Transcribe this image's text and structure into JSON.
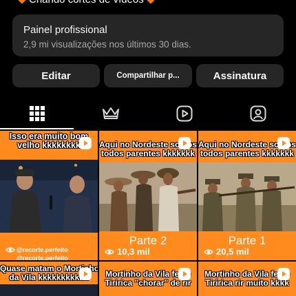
{
  "topline": {
    "text": "Criando cortes de vídeos"
  },
  "panel": {
    "title": "Painel profissional",
    "subtitle": "2,9 mi visualizações nos últimos 30 dias."
  },
  "buttons": {
    "edit": "Editar",
    "share": "Compartilhar p...",
    "subscription": "Assinatura"
  },
  "tabs": [
    {
      "icon": "grid-icon"
    },
    {
      "icon": "crown-icon"
    },
    {
      "icon": "reels-icon"
    },
    {
      "icon": "tagged-icon"
    }
  ],
  "posts": [
    {
      "caption_line1": "Isso era muito bom",
      "caption_line2": "velho kkkkkkkk",
      "handle1": "@recorte.perfeito",
      "handle2": "@recorte.perfeito"
    },
    {
      "caption_line1": "Aqui no Nordeste somos",
      "caption_line2": "todos parentes kkkkkkk",
      "part": "Parte 2",
      "views": "10,3 mil"
    },
    {
      "caption_line1": "Aqui no Nordeste somos",
      "caption_line2": "todos parentes kkkkkkk",
      "part": "Parte 1",
      "views": "20,5 mil"
    },
    {
      "caption_line1": "Quase matam o Mortinho",
      "caption_line2": "da Vila kkkkkkkkkkk"
    },
    {
      "caption_line1": "Mortinho da Vila fez o",
      "caption_line2": "Tiririca \"chorar\" de rir"
    },
    {
      "caption_line1": "Mortinho da Vila fez o",
      "caption_line2": "Tiririca rir muito kkkk"
    }
  ],
  "colors": {
    "accent": "#ff8a1e",
    "panel_bg": "#262626",
    "background": "#000000"
  }
}
